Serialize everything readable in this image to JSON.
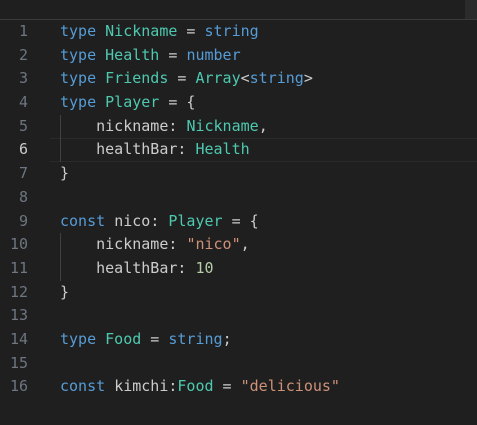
{
  "editor": {
    "lines": [
      {
        "n": "1",
        "tokens": [
          [
            "kw",
            "type"
          ],
          [
            "op",
            " "
          ],
          [
            "ty",
            "Nickname"
          ],
          [
            "op",
            " = "
          ],
          [
            "kw",
            "string"
          ]
        ]
      },
      {
        "n": "2",
        "tokens": [
          [
            "kw",
            "type"
          ],
          [
            "op",
            " "
          ],
          [
            "ty",
            "Health"
          ],
          [
            "op",
            " = "
          ],
          [
            "kw",
            "number"
          ]
        ]
      },
      {
        "n": "3",
        "tokens": [
          [
            "kw",
            "type"
          ],
          [
            "op",
            " "
          ],
          [
            "ty",
            "Friends"
          ],
          [
            "op",
            " = "
          ],
          [
            "ty",
            "Array"
          ],
          [
            "op",
            "<"
          ],
          [
            "kw",
            "string"
          ],
          [
            "op",
            ">"
          ]
        ]
      },
      {
        "n": "4",
        "tokens": [
          [
            "kw",
            "type"
          ],
          [
            "op",
            " "
          ],
          [
            "ty",
            "Player"
          ],
          [
            "op",
            " = {"
          ]
        ]
      },
      {
        "n": "5",
        "guide": true,
        "tokens": [
          [
            "op",
            "    "
          ],
          [
            "prop",
            "nickname"
          ],
          [
            "op",
            ": "
          ],
          [
            "ty",
            "Nickname"
          ],
          [
            "op",
            ","
          ]
        ]
      },
      {
        "n": "6",
        "guide": true,
        "current": true,
        "tokens": [
          [
            "op",
            "    "
          ],
          [
            "prop",
            "healthBar"
          ],
          [
            "op",
            ": "
          ],
          [
            "ty",
            "Health"
          ]
        ]
      },
      {
        "n": "7",
        "tokens": [
          [
            "op",
            "}"
          ]
        ]
      },
      {
        "n": "8",
        "tokens": []
      },
      {
        "n": "9",
        "tokens": [
          [
            "kw",
            "const"
          ],
          [
            "op",
            " "
          ],
          [
            "id",
            "nico"
          ],
          [
            "op",
            ": "
          ],
          [
            "ty",
            "Player"
          ],
          [
            "op",
            " = {"
          ]
        ]
      },
      {
        "n": "10",
        "guide": true,
        "tokens": [
          [
            "op",
            "    "
          ],
          [
            "prop",
            "nickname"
          ],
          [
            "op",
            ": "
          ],
          [
            "str",
            "\"nico\""
          ],
          [
            "op",
            ","
          ]
        ]
      },
      {
        "n": "11",
        "guide": true,
        "tokens": [
          [
            "op",
            "    "
          ],
          [
            "prop",
            "healthBar"
          ],
          [
            "op",
            ": "
          ],
          [
            "num",
            "10"
          ]
        ]
      },
      {
        "n": "12",
        "tokens": [
          [
            "op",
            "}"
          ]
        ]
      },
      {
        "n": "13",
        "tokens": []
      },
      {
        "n": "14",
        "tokens": [
          [
            "kw",
            "type"
          ],
          [
            "op",
            " "
          ],
          [
            "ty",
            "Food"
          ],
          [
            "op",
            " = "
          ],
          [
            "kw",
            "string"
          ],
          [
            "op",
            ";"
          ]
        ]
      },
      {
        "n": "15",
        "tokens": []
      },
      {
        "n": "16",
        "tokens": [
          [
            "kw",
            "const"
          ],
          [
            "op",
            " "
          ],
          [
            "id",
            "kimchi"
          ],
          [
            "op",
            ":"
          ],
          [
            "ty",
            "Food"
          ],
          [
            "op",
            " = "
          ],
          [
            "str",
            "\"delicious\""
          ]
        ]
      }
    ]
  }
}
